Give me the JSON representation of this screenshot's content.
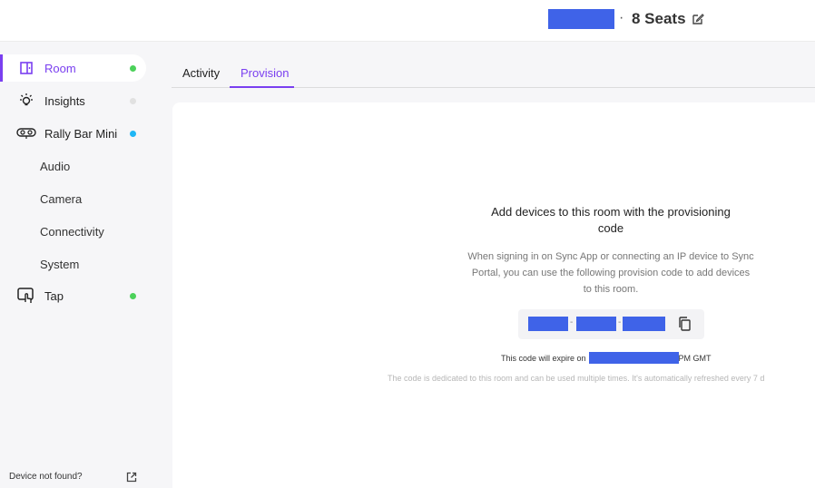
{
  "header": {
    "seats": "8 Seats",
    "separator": "·"
  },
  "sidebar": {
    "items": [
      {
        "label": "Room",
        "icon": "room-icon",
        "status_color": "#4cd15a"
      },
      {
        "label": "Insights",
        "icon": "lightbulb-icon",
        "status_color": "#e1e1e1"
      },
      {
        "label": "Rally Bar Mini",
        "icon": "rally-bar-icon",
        "status_color": "#1fb6f5"
      }
    ],
    "sub_items": [
      "Audio",
      "Camera",
      "Connectivity",
      "System"
    ],
    "tap": {
      "label": "Tap",
      "icon": "tap-icon",
      "status_color": "#4cd15a"
    },
    "footer_link": "Device not found?"
  },
  "tabs": [
    {
      "label": "Activity",
      "active": false
    },
    {
      "label": "Provision",
      "active": true
    }
  ],
  "provision": {
    "title": "Add devices to this room with the provisioning code",
    "description": "When signing in on Sync App or connecting an IP device to Sync Portal, you can use the following provision code to add devices to this room.",
    "code_separator": "-",
    "expire_prefix": "This code will expire on",
    "expire_suffix": "PM GMT",
    "note": "The code is dedicated to this room and can be used multiple times. It's automatically refreshed every 7 d"
  },
  "colors": {
    "accent": "#7a3ff0",
    "redaction": "#3f63e8"
  }
}
